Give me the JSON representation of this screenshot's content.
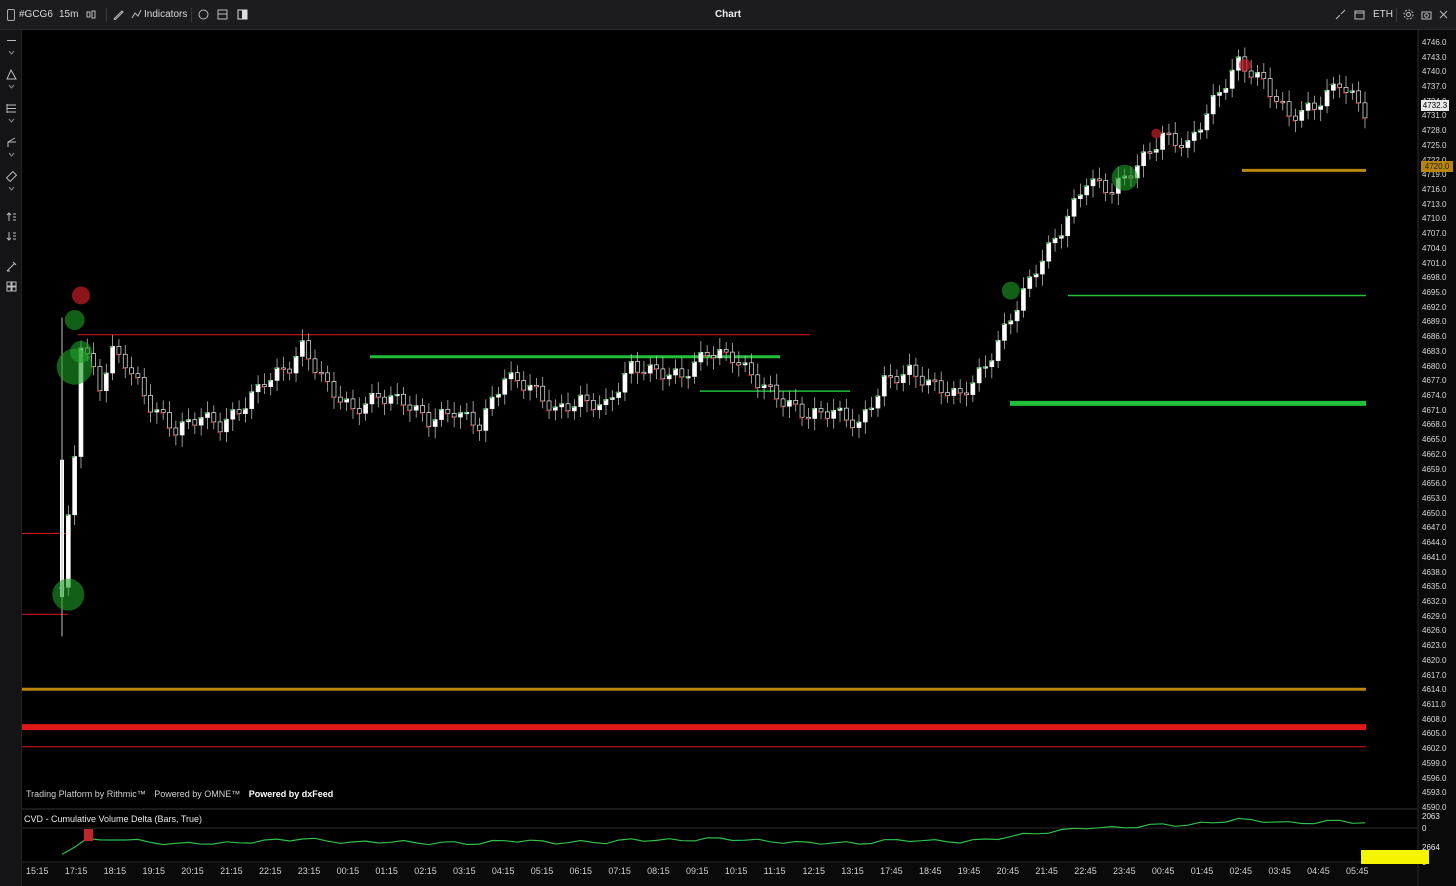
{
  "window": {
    "symbol": "#GCG6",
    "interval": "15m",
    "indicators_label": "Indicators",
    "title": "Chart",
    "session": "ETH"
  },
  "icons": {
    "left": [
      "crosshair-icon",
      "trendline-icon",
      "fib-icon",
      "pitchfork-icon",
      "ruler-icon",
      "long-position-icon",
      "short-position-icon",
      "brush-icon",
      "layout-icon"
    ],
    "top": [
      "candle-type-icon",
      "draw-icon",
      "clock-icon",
      "template-icon",
      "panel-icon",
      "collapse-icon",
      "calendar-icon",
      "settings-icon",
      "close-icon"
    ]
  },
  "branding": {
    "rithmic": "Trading Platform by Rithmic™",
    "omne": "Powered by OMNE™",
    "dxfeed": "Powered by dxFeed"
  },
  "cvd": {
    "label": "CVD - Cumulative Volume Delta (Bars, True)",
    "value_top": "2063",
    "value_zero": "0",
    "value_mid": "2664",
    "value_bottom": "0"
  },
  "price_axis": {
    "last_price": "4732.3",
    "gold_level": "4720.0",
    "ticks": [
      "4746.0",
      "4743.0",
      "4740.0",
      "4737.0",
      "4734.0",
      "4731.0",
      "4728.0",
      "4725.0",
      "4722.0",
      "4719.0",
      "4716.0",
      "4713.0",
      "4710.0",
      "4707.0",
      "4704.0",
      "4701.0",
      "4698.0",
      "4695.0",
      "4692.0",
      "4689.0",
      "4686.0",
      "4683.0",
      "4680.0",
      "4677.0",
      "4674.0",
      "4671.0",
      "4668.0",
      "4665.0",
      "4662.0",
      "4659.0",
      "4656.0",
      "4653.0",
      "4650.0",
      "4647.0",
      "4644.0",
      "4641.0",
      "4638.0",
      "4635.0",
      "4632.0",
      "4629.0",
      "4626.0",
      "4623.0",
      "4620.0",
      "4617.0",
      "4614.0",
      "4611.0",
      "4608.0",
      "4605.0",
      "4602.0",
      "4599.0",
      "4596.0",
      "4593.0",
      "4590.0"
    ]
  },
  "time_axis": [
    "15:15",
    "17:15",
    "18:15",
    "19:15",
    "20:15",
    "21:15",
    "22:15",
    "23:15",
    "00:15",
    "01:15",
    "02:15",
    "03:15",
    "04:15",
    "05:15",
    "06:15",
    "07:15",
    "08:15",
    "09:15",
    "10:15",
    "11:15",
    "12:15",
    "13:15",
    "17:45",
    "18:45",
    "19:45",
    "20:45",
    "21:45",
    "22:45",
    "23:45",
    "00:45",
    "01:45",
    "02:45",
    "03:45",
    "04:45",
    "05:45"
  ],
  "colors": {
    "bull": "#1fa83a",
    "bear": "#c0262b",
    "level_green": "#22c03a",
    "level_red": "#e01818",
    "level_gold": "#b8860b",
    "highlight": "#f5f500"
  },
  "chart_data": {
    "type": "line",
    "title": "",
    "ylim": [
      4590,
      4747
    ],
    "close_path": [
      [
        0,
        4635
      ],
      [
        2,
        4662
      ],
      [
        3,
        4685
      ],
      [
        6,
        4676
      ],
      [
        8,
        4683
      ],
      [
        10,
        4681
      ],
      [
        14,
        4672
      ],
      [
        18,
        4667
      ],
      [
        22,
        4670
      ],
      [
        25,
        4668
      ],
      [
        28,
        4671
      ],
      [
        32,
        4677
      ],
      [
        36,
        4680
      ],
      [
        38,
        4684
      ],
      [
        42,
        4676
      ],
      [
        46,
        4671
      ],
      [
        50,
        4674
      ],
      [
        54,
        4673
      ],
      [
        58,
        4669
      ],
      [
        62,
        4671
      ],
      [
        66,
        4668
      ],
      [
        70,
        4678
      ],
      [
        74,
        4676
      ],
      [
        78,
        4671
      ],
      [
        82,
        4673
      ],
      [
        86,
        4672
      ],
      [
        90,
        4680
      ],
      [
        94,
        4679
      ],
      [
        98,
        4678
      ],
      [
        102,
        4683
      ],
      [
        106,
        4682
      ],
      [
        110,
        4677
      ],
      [
        114,
        4673
      ],
      [
        118,
        4670
      ],
      [
        122,
        4671
      ],
      [
        126,
        4668
      ],
      [
        130,
        4677
      ],
      [
        134,
        4679
      ],
      [
        138,
        4676
      ],
      [
        142,
        4674
      ],
      [
        146,
        4680
      ],
      [
        150,
        4690
      ],
      [
        154,
        4700
      ],
      [
        158,
        4708
      ],
      [
        162,
        4718
      ],
      [
        166,
        4716
      ],
      [
        170,
        4721
      ],
      [
        174,
        4727
      ],
      [
        178,
        4725
      ],
      [
        182,
        4734
      ],
      [
        186,
        4742
      ],
      [
        190,
        4738
      ],
      [
        194,
        4731
      ],
      [
        198,
        4733
      ],
      [
        202,
        4738
      ],
      [
        206,
        4732
      ]
    ],
    "levels": [
      {
        "price": 4720.0,
        "color": "gold"
      },
      {
        "price": 4694.5,
        "color": "green"
      },
      {
        "price": 4672.5,
        "color": "green"
      },
      {
        "price": 4686.5,
        "color": "red"
      },
      {
        "price": 4682.0,
        "color": "green"
      },
      {
        "price": 4675.0,
        "color": "green"
      },
      {
        "price": 4614.2,
        "color": "gold"
      },
      {
        "price": 4606.5,
        "color": "red"
      },
      {
        "price": 4602.5,
        "color": "red"
      },
      {
        "price": 4646.0,
        "color": "red"
      },
      {
        "price": 4629.5,
        "color": "red"
      }
    ],
    "bubbles": [
      {
        "x": 1,
        "price": 4633.5,
        "side": "buy"
      },
      {
        "x": 2,
        "price": 4680,
        "side": "buy"
      },
      {
        "x": 2,
        "price": 4689.5,
        "side": "buy"
      },
      {
        "x": 3,
        "price": 4683,
        "side": "buy"
      },
      {
        "x": 3,
        "price": 4694.5,
        "side": "sell"
      },
      {
        "x": 150,
        "price": 4695.5,
        "side": "buy"
      },
      {
        "x": 168,
        "price": 4718.5,
        "side": "buy"
      },
      {
        "x": 173,
        "price": 4727.5,
        "side": "sell"
      },
      {
        "x": 187,
        "price": 4741.5,
        "side": "sell"
      }
    ]
  }
}
